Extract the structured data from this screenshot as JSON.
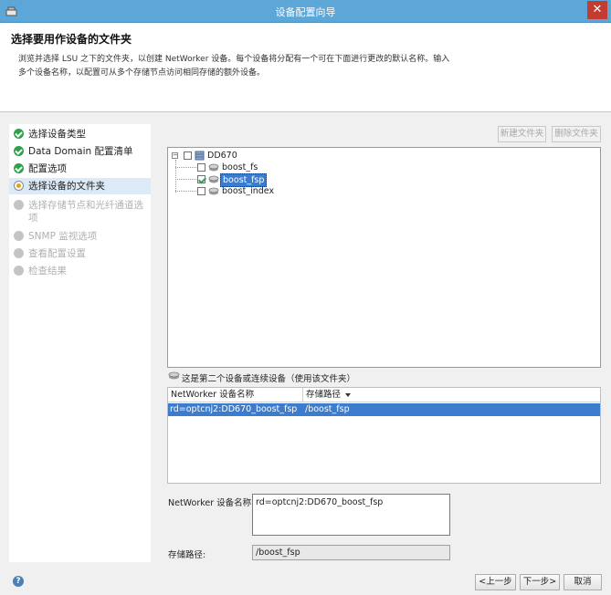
{
  "window": {
    "title": "设备配置向导",
    "close_label": "✕"
  },
  "header": {
    "title": "选择要用作设备的文件夹",
    "description_line1": "浏览并选择 LSU 之下的文件夹，以创建 NetWorker 设备。每个设备将分配有一个可在下面进行更改的默认名称。输入",
    "description_line2": "多个设备名称，以配置可从多个存储节点访问相同存储的额外设备。"
  },
  "steps": [
    {
      "label": "选择设备类型",
      "state": "done"
    },
    {
      "label": "Data Domain 配置清单",
      "state": "done"
    },
    {
      "label": "配置选项",
      "state": "done"
    },
    {
      "label": "选择设备的文件夹",
      "state": "current"
    },
    {
      "label": "选择存储节点和光纤通道选项",
      "state": "pending"
    },
    {
      "label": "SNMP 监视选项",
      "state": "pending"
    },
    {
      "label": "查看配置设置",
      "state": "pending"
    },
    {
      "label": "检查结果",
      "state": "pending"
    }
  ],
  "toolbar": {
    "new_folder_label": "新建文件夹",
    "delete_folder_label": "删除文件夹"
  },
  "tree": {
    "root": {
      "label": "DD670",
      "expander": "−"
    },
    "children": [
      {
        "label": "boost_fs",
        "checked": false,
        "selected": false
      },
      {
        "label": "boost_fsp",
        "checked": true,
        "selected": true
      },
      {
        "label": "boost_index",
        "checked": false,
        "selected": false
      }
    ]
  },
  "device_note": "这是第二个设备或连续设备（使用该文件夹）",
  "device_table": {
    "columns": [
      "NetWorker 设备名称",
      "存储路径"
    ],
    "rows": [
      {
        "name": "rd=optcnj2:DD670_boost_fsp",
        "path": "/boost_fsp"
      }
    ]
  },
  "form": {
    "name_label": "NetWorker 设备名称:",
    "name_value": "rd=optcnj2:DD670_boost_fsp",
    "path_label": "存储路径:",
    "path_value": "/boost_fsp"
  },
  "footer": {
    "help_label": "?",
    "back_label": "<上一步",
    "next_label": "下一步>",
    "cancel_label": "取消"
  },
  "colors": {
    "titlebar": "#5da6d8",
    "selection": "#3b7ccf",
    "done": "#2da24a",
    "current": "#e8a21a",
    "close": "#c43b2f"
  }
}
